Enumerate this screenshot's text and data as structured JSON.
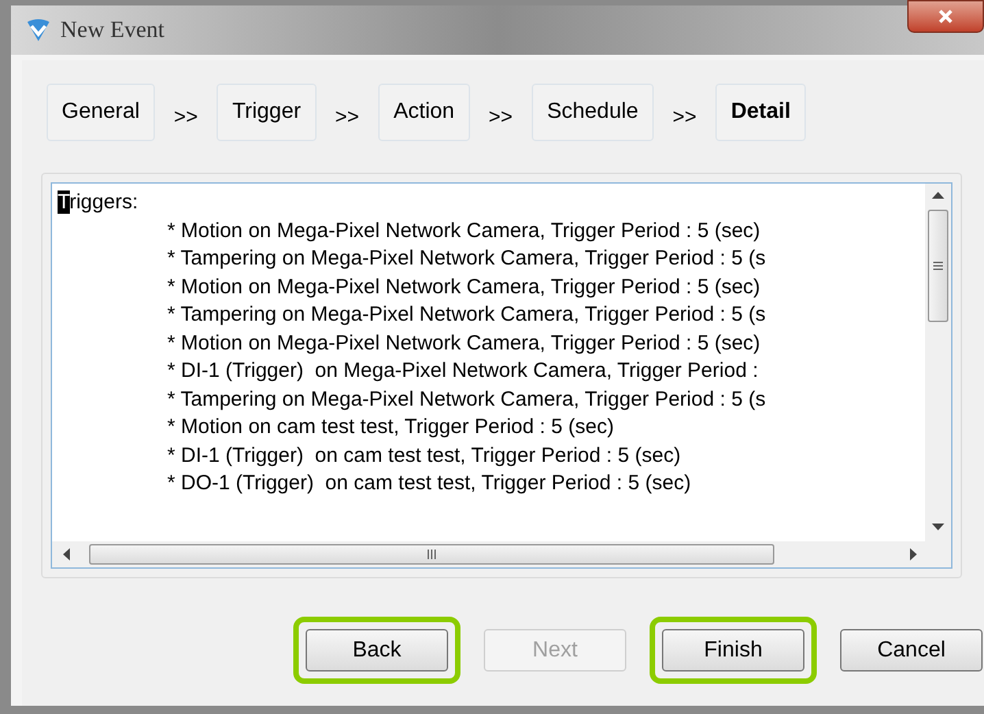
{
  "window": {
    "title": "New Event"
  },
  "steps": [
    {
      "label": "General",
      "selected": false
    },
    {
      "label": "Trigger",
      "selected": false
    },
    {
      "label": "Action",
      "selected": false
    },
    {
      "label": "Schedule",
      "selected": false
    },
    {
      "label": "Detail",
      "selected": true
    }
  ],
  "step_separator": ">>",
  "detail": {
    "heading": "Triggers:",
    "lines": [
      "* Motion on Mega-Pixel Network Camera, Trigger Period : 5 (sec)",
      "* Tampering on Mega-Pixel Network Camera, Trigger Period : 5 (s",
      "* Motion on Mega-Pixel Network Camera, Trigger Period : 5 (sec)",
      "* Tampering on Mega-Pixel Network Camera, Trigger Period : 5 (s",
      "* Motion on Mega-Pixel Network Camera, Trigger Period : 5 (sec)",
      "* DI-1 (Trigger)  on Mega-Pixel Network Camera, Trigger Period :",
      "* Tampering on Mega-Pixel Network Camera, Trigger Period : 5 (s",
      "* Motion on cam test test, Trigger Period : 5 (sec)",
      "* DI-1 (Trigger)  on cam test test, Trigger Period : 5 (sec)",
      "* DO-1 (Trigger)  on cam test test, Trigger Period : 5 (sec)"
    ]
  },
  "buttons": [
    {
      "label": "Back",
      "disabled": false,
      "highlighted": true
    },
    {
      "label": "Next",
      "disabled": true,
      "highlighted": false
    },
    {
      "label": "Finish",
      "disabled": false,
      "highlighted": true
    },
    {
      "label": "Cancel",
      "disabled": false,
      "highlighted": false
    }
  ]
}
